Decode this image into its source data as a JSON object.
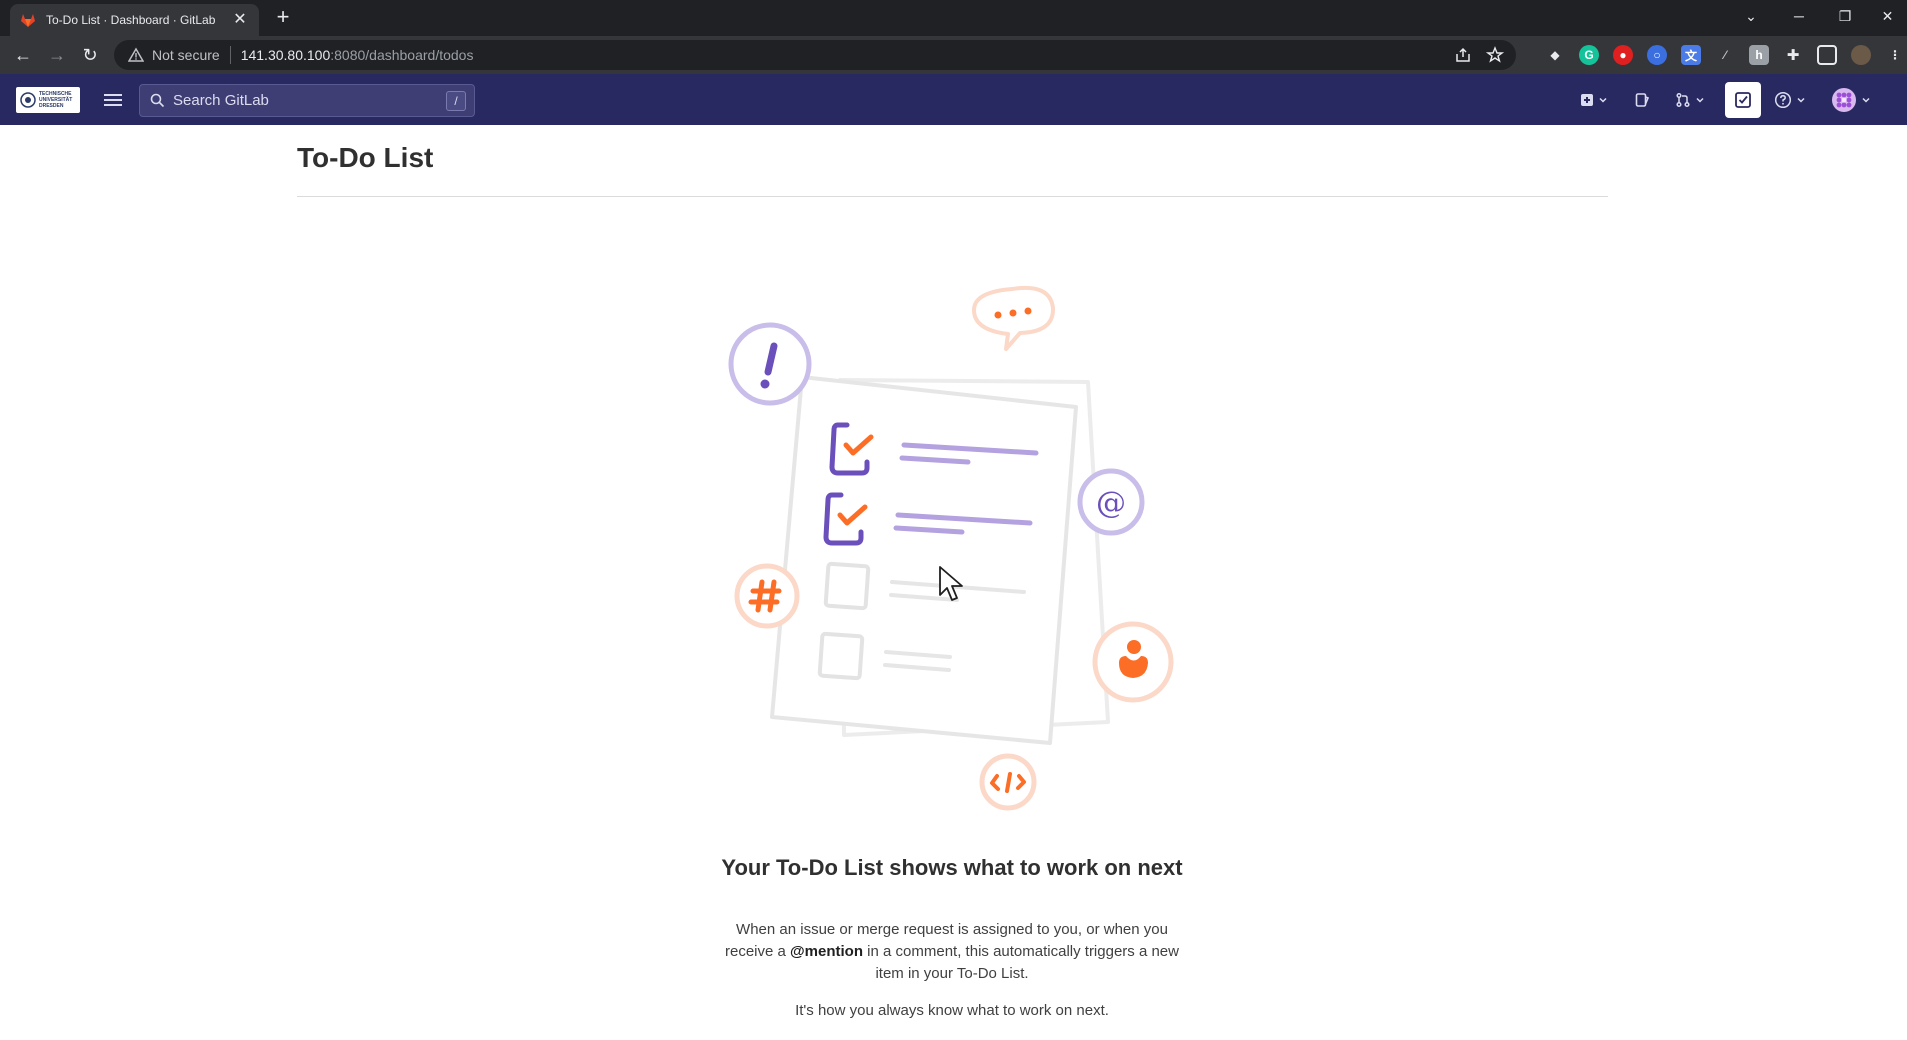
{
  "browser": {
    "tab_title": "To-Do List · Dashboard · GitLab",
    "new_tab": "+",
    "security_label": "Not secure",
    "url_host": "141.30.80.100",
    "url_rest": ":8080/dashboard/todos"
  },
  "gitlab": {
    "search_placeholder": "Search GitLab",
    "search_shortcut": "/"
  },
  "page": {
    "title": "To-Do List",
    "empty_heading": "Your To-Do List shows what to work on next",
    "empty_desc_before": "When an issue or merge request is assigned to you, or when you receive a ",
    "empty_desc_mention": "@mention",
    "empty_desc_after": " in a comment, this automatically triggers a new item in your To-Do List.",
    "empty_tail": "It's how you always know what to work on next."
  },
  "colors": {
    "gitlab_nav": "#292961",
    "accent_purple": "#6b4fbb",
    "accent_orange": "#fc6d26"
  }
}
